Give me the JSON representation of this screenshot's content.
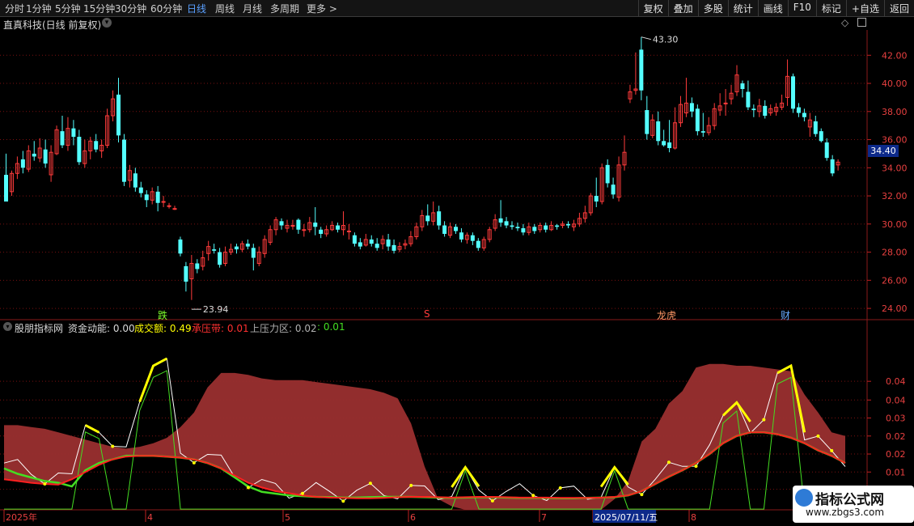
{
  "periods": [
    "分时",
    "1分钟",
    "5分钟",
    "15分钟",
    "30分钟",
    "60分钟",
    "日线",
    "周线",
    "月线",
    "多周期",
    "更多 >"
  ],
  "active_period": "日线",
  "toolbar": [
    "复权",
    "叠加",
    "多股",
    "统计",
    "画线",
    "F10",
    "标记",
    "+自选",
    "返回"
  ],
  "stock_title": "直真科技(日线 前复权)",
  "price_axis": [
    "42.00",
    "40.00",
    "38.00",
    "36.00",
    "34.00",
    "32.00",
    "30.00",
    "28.00",
    "26.00",
    "24.00"
  ],
  "current_price": "34.40",
  "high_label": "43.30",
  "low_label": "23.94",
  "markers": {
    "die": "跌",
    "s": "S",
    "longhu": "龙虎",
    "cai": "财"
  },
  "indicator": {
    "name": "股朋指标网",
    "funds_label": "资金动能:",
    "funds_value": "0.00",
    "volume_label": "成交额:",
    "volume_value": "0.49",
    "support_label": "承压带:",
    "support_value": "0.01",
    "pressure_label": "上压力区:",
    "pressure_value": "0.02",
    "extra_value": ": 0.01"
  },
  "indicator_axis": [
    "0.04",
    "0.04",
    "0.03",
    "0.02",
    "0.02",
    "0.01",
    "0.01"
  ],
  "time_axis": [
    "2025年",
    "4",
    "5",
    "6",
    "7",
    "2025/07/11/五",
    "8"
  ],
  "watermark": {
    "line1": "指标公式网",
    "line2": "www.zbgs3.com"
  },
  "colors": {
    "up": "#ff3b3b",
    "down": "#54ffff",
    "band": "#9a2f2f",
    "support_line": "#ff2020",
    "green_line": "#44dd22",
    "yellow": "#ffff00",
    "white": "#ffffff",
    "grid": "#7a1010"
  },
  "chart_data": [
    {
      "type": "candlestick",
      "title": "直真科技(日线 前复权)",
      "ylim": [
        23.2,
        43.8
      ],
      "y_ticks": [
        24,
        26,
        28,
        30,
        32,
        34,
        36,
        38,
        40,
        42
      ],
      "x_ticks": [
        "2025年",
        "4",
        "5",
        "6",
        "7",
        "8"
      ],
      "bars": [
        [
          33.5,
          31.6,
          35.0,
          31.6
        ],
        [
          32.3,
          33.6,
          33.8,
          32.0
        ],
        [
          33.6,
          34.3,
          34.8,
          33.2
        ],
        [
          34.6,
          34.0,
          35.2,
          33.6
        ],
        [
          33.9,
          35.2,
          35.6,
          33.7
        ],
        [
          35.0,
          34.8,
          35.9,
          34.5
        ],
        [
          34.7,
          35.4,
          36.1,
          34.4
        ],
        [
          35.3,
          34.3,
          36.0,
          34.0
        ],
        [
          33.5,
          35.1,
          35.6,
          33.0
        ],
        [
          35.0,
          36.7,
          37.0,
          34.9
        ],
        [
          36.6,
          35.6,
          37.7,
          35.4
        ],
        [
          35.6,
          36.8,
          37.6,
          35.2
        ],
        [
          36.8,
          36.2,
          37.4,
          35.6
        ],
        [
          36.2,
          34.4,
          36.7,
          34.2
        ],
        [
          34.3,
          35.2,
          36.0,
          34.0
        ],
        [
          35.2,
          35.9,
          36.2,
          34.6
        ],
        [
          35.9,
          35.3,
          36.4,
          35.1
        ],
        [
          35.2,
          35.6,
          36.0,
          34.7
        ],
        [
          35.6,
          37.7,
          38.2,
          35.4
        ],
        [
          37.7,
          38.9,
          39.5,
          37.3
        ],
        [
          39.2,
          36.3,
          40.4,
          35.8
        ],
        [
          36.0,
          33.0,
          36.4,
          32.7
        ],
        [
          33.1,
          33.8,
          34.2,
          32.6
        ],
        [
          33.6,
          32.6,
          34.0,
          32.3
        ],
        [
          32.6,
          32.2,
          33.0,
          31.9
        ],
        [
          32.1,
          31.7,
          32.4,
          31.2
        ],
        [
          31.7,
          32.3,
          32.6,
          31.4
        ],
        [
          32.3,
          31.5,
          32.7,
          30.9
        ],
        [
          31.6,
          31.6,
          32.0,
          31.2
        ],
        [
          31.3,
          31.3,
          31.5,
          31.1
        ],
        [
          31.1,
          31.1,
          31.3,
          31.0
        ],
        [
          28.9,
          27.9,
          29.1,
          27.7
        ],
        [
          27.0,
          25.9,
          27.3,
          25.2
        ],
        [
          26.1,
          27.2,
          27.8,
          24.6
        ],
        [
          27.2,
          26.8,
          27.5,
          26.5
        ],
        [
          27.0,
          27.6,
          28.1,
          26.7
        ],
        [
          27.9,
          28.4,
          28.8,
          27.4
        ],
        [
          28.2,
          28.1,
          28.6,
          27.9
        ],
        [
          28.0,
          27.1,
          28.3,
          26.9
        ],
        [
          27.2,
          28.0,
          28.4,
          27.0
        ],
        [
          28.0,
          28.2,
          28.6,
          27.8
        ],
        [
          28.4,
          28.2,
          28.6,
          27.9
        ],
        [
          28.2,
          28.6,
          28.8,
          28.0
        ],
        [
          28.6,
          28.4,
          28.9,
          28.2
        ],
        [
          28.3,
          27.6,
          28.6,
          26.7
        ],
        [
          27.2,
          28.0,
          28.4,
          27.0
        ],
        [
          27.9,
          28.9,
          29.2,
          27.6
        ],
        [
          28.7,
          29.6,
          29.9,
          28.5
        ],
        [
          29.6,
          30.3,
          30.5,
          29.2
        ],
        [
          30.2,
          29.9,
          30.4,
          29.6
        ],
        [
          29.7,
          29.9,
          30.3,
          29.4
        ],
        [
          29.9,
          29.9,
          30.3,
          29.6
        ],
        [
          30.3,
          29.6,
          30.4,
          29.3
        ],
        [
          29.6,
          29.6,
          30.0,
          29.1
        ],
        [
          29.6,
          30.1,
          30.5,
          29.4
        ],
        [
          30.1,
          29.8,
          31.2,
          29.2
        ],
        [
          29.6,
          29.3,
          29.8,
          29.0
        ],
        [
          29.3,
          29.6,
          29.9,
          29.1
        ],
        [
          29.6,
          29.9,
          30.2,
          29.5
        ],
        [
          29.9,
          29.6,
          30.1,
          29.4
        ],
        [
          29.6,
          29.9,
          30.9,
          29.2
        ],
        [
          29.5,
          29.5,
          30.0,
          28.9
        ],
        [
          29.2,
          28.6,
          29.4,
          28.4
        ],
        [
          28.7,
          28.4,
          29.0,
          28.2
        ],
        [
          28.5,
          28.9,
          29.3,
          28.4
        ],
        [
          28.9,
          28.6,
          29.2,
          28.4
        ],
        [
          28.6,
          28.3,
          29.0,
          28.1
        ],
        [
          28.6,
          28.9,
          29.2,
          28.2
        ],
        [
          28.9,
          28.4,
          29.3,
          28.1
        ],
        [
          28.5,
          28.1,
          28.9,
          27.9
        ],
        [
          28.2,
          28.4,
          28.7,
          28.0
        ],
        [
          28.5,
          28.6,
          28.9,
          28.2
        ],
        [
          28.6,
          29.1,
          29.5,
          28.4
        ],
        [
          29.1,
          29.8,
          30.1,
          28.9
        ],
        [
          29.8,
          30.6,
          31.0,
          29.5
        ],
        [
          30.6,
          30.2,
          31.4,
          29.9
        ],
        [
          30.2,
          30.8,
          31.6,
          29.9
        ],
        [
          30.9,
          29.9,
          31.3,
          29.6
        ],
        [
          29.9,
          29.3,
          30.2,
          29.1
        ],
        [
          29.2,
          29.8,
          30.1,
          29.0
        ],
        [
          29.8,
          29.5,
          30.0,
          29.3
        ],
        [
          29.4,
          28.9,
          29.7,
          28.7
        ],
        [
          28.9,
          29.2,
          29.4,
          28.6
        ],
        [
          29.2,
          28.8,
          29.4,
          28.5
        ],
        [
          28.8,
          28.3,
          29.0,
          28.1
        ],
        [
          28.3,
          28.9,
          29.1,
          28.1
        ],
        [
          28.9,
          29.6,
          29.8,
          28.7
        ],
        [
          29.7,
          30.3,
          30.7,
          29.5
        ],
        [
          30.4,
          30.1,
          31.7,
          29.8
        ],
        [
          30.2,
          29.9,
          30.5,
          29.7
        ],
        [
          29.9,
          29.8,
          30.2,
          29.6
        ],
        [
          29.8,
          29.7,
          30.1,
          29.5
        ],
        [
          29.7,
          29.4,
          30.0,
          29.2
        ],
        [
          29.4,
          29.8,
          30.1,
          29.2
        ],
        [
          29.8,
          29.5,
          30.0,
          29.3
        ],
        [
          29.6,
          29.9,
          30.1,
          29.4
        ],
        [
          29.9,
          29.6,
          30.1,
          29.4
        ],
        [
          29.6,
          29.9,
          30.2,
          29.5
        ],
        [
          29.9,
          29.8,
          30.0,
          29.6
        ],
        [
          29.9,
          30.0,
          30.2,
          29.7
        ],
        [
          30.0,
          29.9,
          30.2,
          29.7
        ],
        [
          29.8,
          30.0,
          30.3,
          29.5
        ],
        [
          30.0,
          30.4,
          30.8,
          29.8
        ],
        [
          30.4,
          30.8,
          31.3,
          30.1
        ],
        [
          30.8,
          32.0,
          32.2,
          30.6
        ],
        [
          32.0,
          31.6,
          33.3,
          31.2
        ],
        [
          31.6,
          34.0,
          34.3,
          31.4
        ],
        [
          34.2,
          32.9,
          34.6,
          32.6
        ],
        [
          32.8,
          32.1,
          33.3,
          31.8
        ],
        [
          31.9,
          34.2,
          34.8,
          31.6
        ],
        [
          34.2,
          35.1,
          36.3,
          33.8
        ],
        [
          38.9,
          39.4,
          39.9,
          38.6
        ],
        [
          39.5,
          39.6,
          42.2,
          39.2
        ],
        [
          42.4,
          39.5,
          43.3,
          38.8
        ],
        [
          38.1,
          36.4,
          39.1,
          36.0
        ],
        [
          36.3,
          37.4,
          37.8,
          36.1
        ],
        [
          37.3,
          35.9,
          38.0,
          35.6
        ],
        [
          35.9,
          35.6,
          36.7,
          35.5
        ],
        [
          35.8,
          35.4,
          37.4,
          35.1
        ],
        [
          35.4,
          37.2,
          38.3,
          35.3
        ],
        [
          37.2,
          38.5,
          39.1,
          36.9
        ],
        [
          37.9,
          38.6,
          40.4,
          37.6
        ],
        [
          38.6,
          38.0,
          39.0,
          37.6
        ],
        [
          38.2,
          36.6,
          38.5,
          36.3
        ],
        [
          36.6,
          36.5,
          37.9,
          36.2
        ],
        [
          36.5,
          37.0,
          37.6,
          36.3
        ],
        [
          37.0,
          38.2,
          38.6,
          36.7
        ],
        [
          38.1,
          38.4,
          39.3,
          37.7
        ],
        [
          38.6,
          38.6,
          39.6,
          37.7
        ],
        [
          38.9,
          39.3,
          39.9,
          38.5
        ],
        [
          39.4,
          40.6,
          41.3,
          39.1
        ],
        [
          40.0,
          39.6,
          40.2,
          39.0
        ],
        [
          39.4,
          38.3,
          40.2,
          38.1
        ],
        [
          38.2,
          38.1,
          38.5,
          37.6
        ],
        [
          38.0,
          38.4,
          38.9,
          37.6
        ],
        [
          38.4,
          37.7,
          38.8,
          37.5
        ],
        [
          37.9,
          38.2,
          38.5,
          37.7
        ],
        [
          38.0,
          38.3,
          38.6,
          37.7
        ],
        [
          38.3,
          38.6,
          39.2,
          38.1
        ],
        [
          39.0,
          40.5,
          41.7,
          38.4
        ],
        [
          40.5,
          38.2,
          40.7,
          37.9
        ],
        [
          38.3,
          37.9,
          38.6,
          37.6
        ],
        [
          37.9,
          37.6,
          38.2,
          37.3
        ],
        [
          36.9,
          37.4,
          37.9,
          36.2
        ],
        [
          37.3,
          36.4,
          37.7,
          36.2
        ],
        [
          36.6,
          35.9,
          36.8,
          35.8
        ],
        [
          35.8,
          34.7,
          36.1,
          34.5
        ],
        [
          34.6,
          33.6,
          34.9,
          33.4
        ],
        [
          34.2,
          34.4,
          34.6,
          33.8
        ]
      ],
      "annotations": {
        "high": 43.3,
        "low": 23.94,
        "last": 34.4
      }
    },
    {
      "type": "line",
      "title": "股朋指标网",
      "ylim": [
        0,
        0.049
      ],
      "y_ticks": [
        0.01,
        0.01,
        0.02,
        0.02,
        0.03,
        0.04,
        0.04
      ],
      "series": [
        {
          "name": "上压力区",
          "values": [
            0.0235,
            0.0235,
            0.023,
            0.0225,
            0.0215,
            0.0205,
            0.0195,
            0.0185,
            0.0175,
            0.017,
            0.0175,
            0.0185,
            0.02,
            0.023,
            0.027,
            0.034,
            0.038,
            0.038,
            0.0375,
            0.0365,
            0.036,
            0.036,
            0.036,
            0.0355,
            0.035,
            0.0345,
            0.034,
            0.0335,
            0.0325,
            0.031,
            0.024,
            0.012,
            0.003,
            0.001,
            0.0,
            0.0,
            0.0,
            0.0,
            0.0,
            0.0,
            0.0,
            0.0,
            0.0,
            0.0,
            0.0,
            0.003,
            0.008,
            0.019,
            0.0225,
            0.0295,
            0.033,
            0.0395,
            0.0405,
            0.0405,
            0.04,
            0.04,
            0.0395,
            0.039,
            0.0385,
            0.032,
            0.027,
            0.0215,
            0.0205
          ]
        },
        {
          "name": "承压带",
          "values": [
            0.0085,
            0.008,
            0.0075,
            0.0072,
            0.007,
            0.0085,
            0.0105,
            0.0125,
            0.014,
            0.0148,
            0.015,
            0.015,
            0.0148,
            0.0145,
            0.014,
            0.013,
            0.0115,
            0.0095,
            0.0075,
            0.0062,
            0.0052,
            0.0046,
            0.004,
            0.0036,
            0.0034,
            0.0033,
            0.0032,
            0.0032,
            0.0033,
            0.0035,
            0.0036,
            0.0036,
            0.0035,
            0.0034,
            0.0035,
            0.0036,
            0.0036,
            0.0035,
            0.0034,
            0.0034,
            0.0034,
            0.0033,
            0.0033,
            0.0033,
            0.0034,
            0.0036,
            0.004,
            0.0052,
            0.0072,
            0.0092,
            0.011,
            0.013,
            0.0155,
            0.0185,
            0.0205,
            0.0215,
            0.0215,
            0.021,
            0.02,
            0.0185,
            0.0165,
            0.015,
            0.013
          ]
        },
        {
          "name": "资金动能",
          "values": [
            0.0115,
            0.01,
            0.009,
            0.008,
            0.0075,
            0.0065,
            0.011,
            0.013,
            0.014,
            0.015,
            0.015,
            0.015,
            0.0148,
            0.0145,
            0.014,
            0.013,
            0.0115,
            0.009,
            0.0065,
            0.005,
            0.0045,
            0.004,
            0.0038,
            0.0036,
            0.0035,
            0.0034,
            0.0034,
            0.0035,
            0.0036,
            0.0036,
            0.0036,
            0.0035,
            0.0034,
            0.0033,
            0.0034,
            0.0035,
            0.0035,
            0.0034,
            0.0033,
            0.0033,
            0.0033,
            0.0032,
            0.0032,
            0.0033,
            0.0034,
            0.0035,
            0.004,
            0.0052,
            0.0072,
            0.0092,
            0.011,
            0.013,
            0.0155,
            0.0185,
            0.0205,
            0.0215,
            0.0215,
            0.021,
            0.02,
            0.0185,
            0.0165,
            0.015,
            0.013
          ]
        }
      ]
    }
  ]
}
